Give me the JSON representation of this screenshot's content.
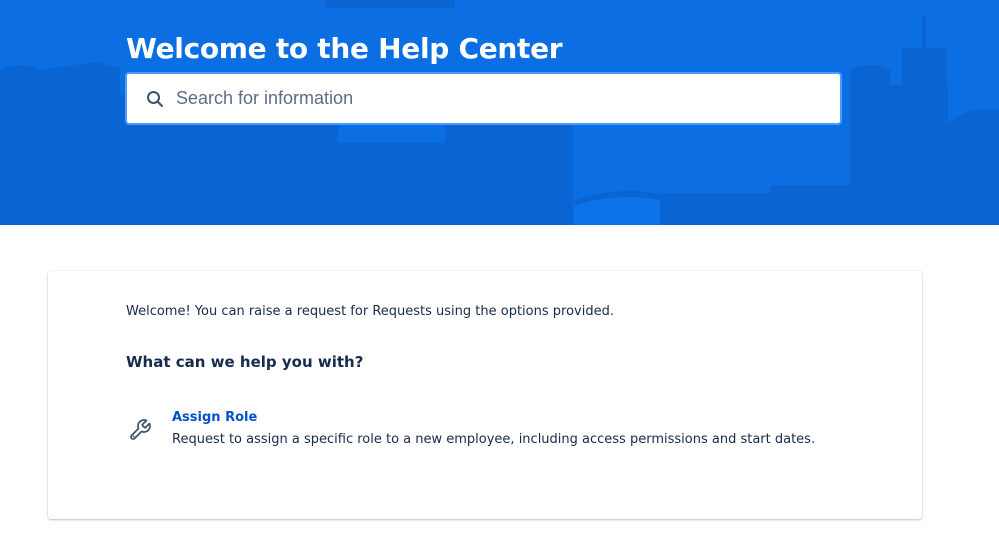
{
  "header": {
    "title": "Welcome to the Help Center",
    "search": {
      "placeholder": "Search for information",
      "value": "",
      "icon": "search-icon"
    },
    "colors": {
      "background": "#0b6ee3",
      "skyline": "#0a63cf"
    }
  },
  "main": {
    "welcome_message": "Welcome! You can raise a request for Requests using the options provided.",
    "heading": "What can we help you with?",
    "request_types": [
      {
        "title": "Assign Role",
        "description": "Request to assign a specific role to a new employee, including access permissions and start dates.",
        "icon": "wrench-icon"
      }
    ],
    "colors": {
      "link": "#0052cc",
      "text": "#172b4d"
    }
  }
}
